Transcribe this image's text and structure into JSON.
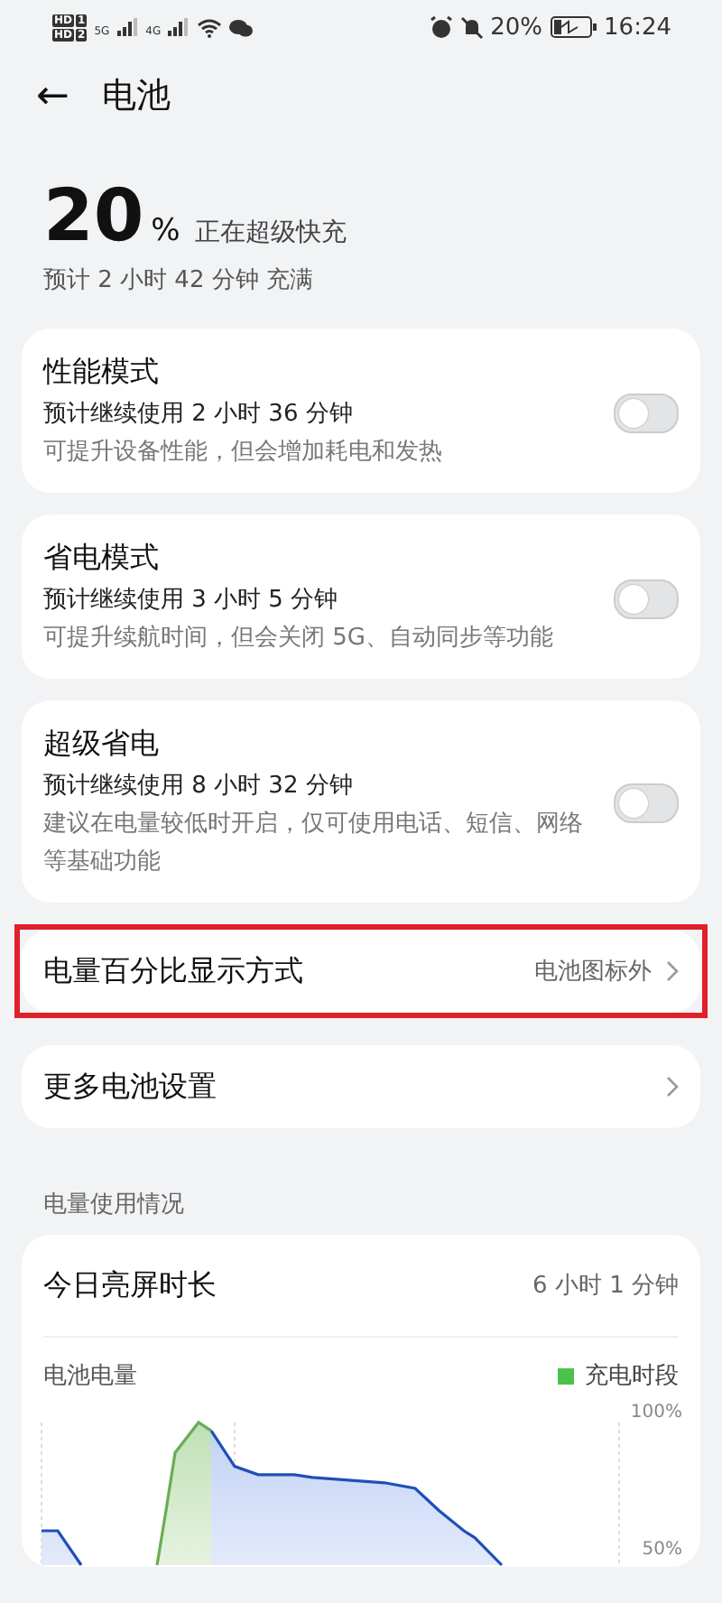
{
  "status_bar": {
    "sims": [
      {
        "badge": "HD",
        "slot": "1",
        "network": "5G"
      },
      {
        "badge": "HD",
        "slot": "2",
        "network": "4G"
      }
    ],
    "battery_text": "20%",
    "time": "16:24"
  },
  "header": {
    "back": "←",
    "title": "电池"
  },
  "battery": {
    "percent": "20",
    "unit": "%",
    "status": "正在超级快充",
    "estimate": "预计 2 小时 42 分钟 充满"
  },
  "modes": [
    {
      "title": "性能模式",
      "usage": "预计继续使用 2 小时 36 分钟",
      "description": "可提升设备性能，但会增加耗电和发热",
      "on": false
    },
    {
      "title": "省电模式",
      "usage": "预计继续使用 3 小时 5 分钟",
      "description": "可提升续航时间，但会关闭 5G、自动同步等功能",
      "on": false
    },
    {
      "title": "超级省电",
      "usage": "预计继续使用 8 小时 32 分钟",
      "description": "建议在电量较低时开启，仅可使用电话、短信、网络等基础功能",
      "on": false
    }
  ],
  "settings": [
    {
      "label": "电量百分比显示方式",
      "value": "电池图标外",
      "highlighted": true
    },
    {
      "label": "更多电池设置",
      "highlighted": false
    }
  ],
  "usage": {
    "section": "电量使用情况",
    "screen_time_label": "今日亮屏时长",
    "screen_time": "6 小时 1 分钟",
    "chart_title": "电池电量",
    "legend": [
      {
        "label": "充电时段",
        "color": "#4cc24c"
      }
    ],
    "axis_labels": [
      "100%",
      "50%"
    ]
  }
}
